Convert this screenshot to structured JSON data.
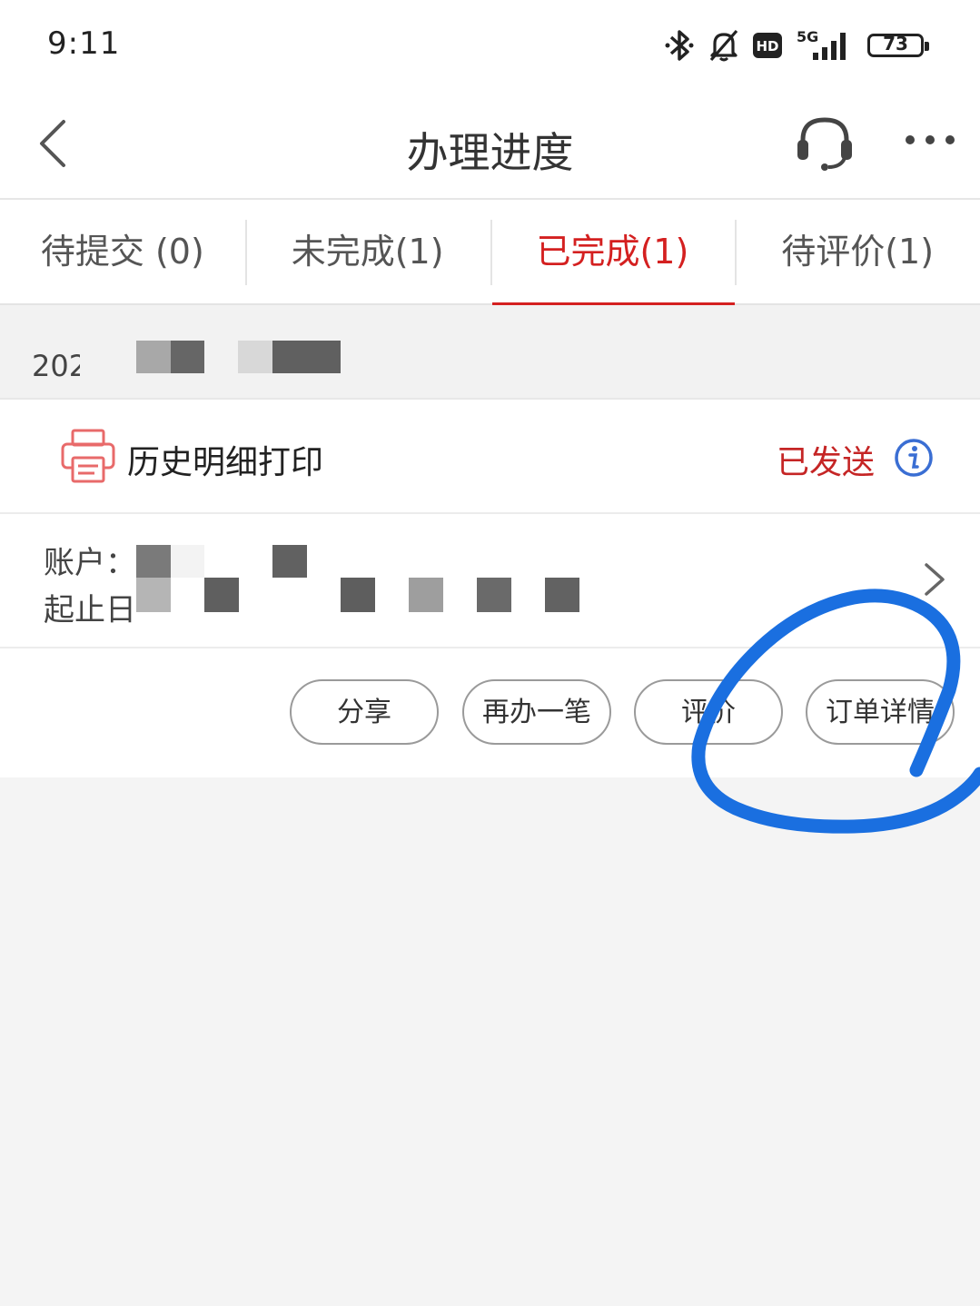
{
  "status_bar": {
    "time": "9:11",
    "network": "5G",
    "hd_label": "HD",
    "battery": "73",
    "icons": [
      "bluetooth-icon",
      "mute-bell-icon",
      "hd-icon",
      "signal-icon",
      "battery-icon"
    ]
  },
  "navbar": {
    "title": "办理进度",
    "back_icon": "chevron-left-icon",
    "support_icon": "headset-icon",
    "more_icon": "more-dots-icon"
  },
  "tabs": [
    {
      "label": "待提交 (0)",
      "active": false
    },
    {
      "label": "未完成(1)",
      "active": false
    },
    {
      "label": "已完成(1)",
      "active": true
    },
    {
      "label": "待评价(1)",
      "active": false
    }
  ],
  "order": {
    "date_prefix": "202",
    "service_name": "历史明细打印",
    "status": "已发送",
    "account_label": "账户：",
    "date_range_label": "起止日",
    "buttons": {
      "share": "分享",
      "again": "再办一笔",
      "review": "评价",
      "detail": "订单详情"
    }
  },
  "colors": {
    "accent": "#d42020",
    "status_sent": "#c52525",
    "info_icon": "#3a6ed3",
    "annotation_circle": "#1a6fe0"
  }
}
